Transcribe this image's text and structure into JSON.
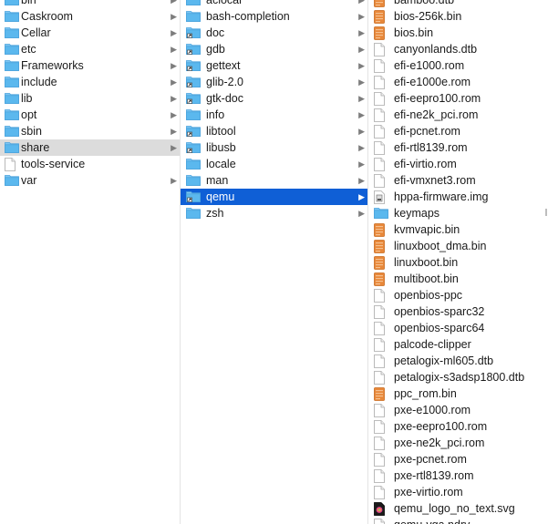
{
  "columns": [
    {
      "items": [
        {
          "label": "bin",
          "icon": "folder-icon",
          "chevron": true
        },
        {
          "label": "Caskroom",
          "icon": "folder-icon",
          "chevron": true
        },
        {
          "label": "Cellar",
          "icon": "folder-icon",
          "chevron": true
        },
        {
          "label": "etc",
          "icon": "folder-icon",
          "chevron": true
        },
        {
          "label": "Frameworks",
          "icon": "folder-icon",
          "chevron": true
        },
        {
          "label": "include",
          "icon": "folder-icon",
          "chevron": true
        },
        {
          "label": "lib",
          "icon": "folder-icon",
          "chevron": true
        },
        {
          "label": "opt",
          "icon": "folder-icon",
          "chevron": true
        },
        {
          "label": "sbin",
          "icon": "folder-icon",
          "chevron": true
        },
        {
          "label": "share",
          "icon": "folder-icon",
          "chevron": true,
          "selected": "gray"
        },
        {
          "label": "tools-service",
          "icon": "file-icon",
          "chevron": false
        },
        {
          "label": "var",
          "icon": "folder-icon",
          "chevron": true
        }
      ]
    },
    {
      "items": [
        {
          "label": "aclocal",
          "icon": "folder-icon",
          "chevron": true
        },
        {
          "label": "bash-completion",
          "icon": "folder-icon",
          "chevron": true
        },
        {
          "label": "doc",
          "icon": "alias-folder-icon",
          "chevron": true
        },
        {
          "label": "gdb",
          "icon": "alias-folder-icon",
          "chevron": true
        },
        {
          "label": "gettext",
          "icon": "alias-folder-icon",
          "chevron": true
        },
        {
          "label": "glib-2.0",
          "icon": "alias-folder-icon",
          "chevron": true
        },
        {
          "label": "gtk-doc",
          "icon": "alias-folder-icon",
          "chevron": true
        },
        {
          "label": "info",
          "icon": "folder-icon",
          "chevron": true
        },
        {
          "label": "libtool",
          "icon": "alias-folder-icon",
          "chevron": true
        },
        {
          "label": "libusb",
          "icon": "alias-folder-icon",
          "chevron": true
        },
        {
          "label": "locale",
          "icon": "folder-icon",
          "chevron": true
        },
        {
          "label": "man",
          "icon": "folder-icon",
          "chevron": true
        },
        {
          "label": "qemu",
          "icon": "alias-folder-icon",
          "chevron": true,
          "selected": "blue"
        },
        {
          "label": "zsh",
          "icon": "folder-icon",
          "chevron": true
        }
      ]
    },
    {
      "items": [
        {
          "label": "bamboo.dtb",
          "icon": "binary-file-icon"
        },
        {
          "label": "bios-256k.bin",
          "icon": "binary-file-icon"
        },
        {
          "label": "bios.bin",
          "icon": "binary-file-icon"
        },
        {
          "label": "canyonlands.dtb",
          "icon": "file-icon"
        },
        {
          "label": "efi-e1000.rom",
          "icon": "file-icon"
        },
        {
          "label": "efi-e1000e.rom",
          "icon": "file-icon"
        },
        {
          "label": "efi-eepro100.rom",
          "icon": "file-icon"
        },
        {
          "label": "efi-ne2k_pci.rom",
          "icon": "file-icon"
        },
        {
          "label": "efi-pcnet.rom",
          "icon": "file-icon"
        },
        {
          "label": "efi-rtl8139.rom",
          "icon": "file-icon"
        },
        {
          "label": "efi-virtio.rom",
          "icon": "file-icon"
        },
        {
          "label": "efi-vmxnet3.rom",
          "icon": "file-icon"
        },
        {
          "label": "hppa-firmware.img",
          "icon": "disk-image-icon"
        },
        {
          "label": "keymaps",
          "icon": "folder-icon",
          "chevron": true
        },
        {
          "label": "kvmvapic.bin",
          "icon": "binary-file-icon"
        },
        {
          "label": "linuxboot_dma.bin",
          "icon": "binary-file-icon"
        },
        {
          "label": "linuxboot.bin",
          "icon": "binary-file-icon"
        },
        {
          "label": "multiboot.bin",
          "icon": "binary-file-icon"
        },
        {
          "label": "openbios-ppc",
          "icon": "file-icon"
        },
        {
          "label": "openbios-sparc32",
          "icon": "file-icon"
        },
        {
          "label": "openbios-sparc64",
          "icon": "file-icon"
        },
        {
          "label": "palcode-clipper",
          "icon": "file-icon"
        },
        {
          "label": "petalogix-ml605.dtb",
          "icon": "file-icon"
        },
        {
          "label": "petalogix-s3adsp1800.dtb",
          "icon": "file-icon"
        },
        {
          "label": "ppc_rom.bin",
          "icon": "binary-file-icon"
        },
        {
          "label": "pxe-e1000.rom",
          "icon": "file-icon"
        },
        {
          "label": "pxe-eepro100.rom",
          "icon": "file-icon"
        },
        {
          "label": "pxe-ne2k_pci.rom",
          "icon": "file-icon"
        },
        {
          "label": "pxe-pcnet.rom",
          "icon": "file-icon"
        },
        {
          "label": "pxe-rtl8139.rom",
          "icon": "file-icon"
        },
        {
          "label": "pxe-virtio.rom",
          "icon": "file-icon"
        },
        {
          "label": "qemu_logo_no_text.svg",
          "icon": "svg-image-icon"
        },
        {
          "label": "qemu-vga.ndrv",
          "icon": "file-icon"
        }
      ]
    }
  ],
  "colors": {
    "folder": "#5bb8ee",
    "selection_blue": "#0f5fd6",
    "selection_gray": "#dcdcdc",
    "binary_icon": "#e8883a"
  }
}
